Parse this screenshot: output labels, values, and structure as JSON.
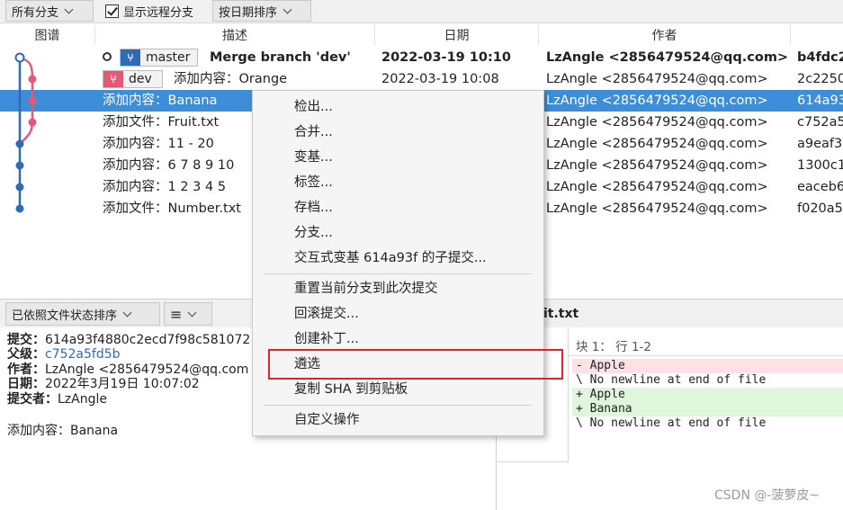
{
  "toolbar": {
    "branch_filter": "所有分支",
    "show_remote_label": "显示远程分支",
    "sort_label": "按日期排序"
  },
  "columns": {
    "graph": "图谱",
    "desc": "描述",
    "date": "日期",
    "author": "作者"
  },
  "commits": [
    {
      "desc": "Merge branch 'dev'",
      "date": "2022-03-19 10:10",
      "author": "LzAngle <2856479524@qq.com>",
      "sha": "b4fdc2"
    },
    {
      "desc": "添加内容：Orange",
      "date": "2022-03-19 10:08",
      "author": "LzAngle <2856479524@qq.com>",
      "sha": "2c2250"
    },
    {
      "desc": "添加内容：Banana",
      "date": "",
      "author": "LzAngle <2856479524@qq.com>",
      "sha": "614a93"
    },
    {
      "desc": "添加文件：Fruit.txt",
      "date": "",
      "author": "LzAngle <2856479524@qq.com>",
      "sha": "c752a5"
    },
    {
      "desc": "添加内容：11 - 20",
      "date": "",
      "author": "LzAngle <2856479524@qq.com>",
      "sha": "a9eaf3"
    },
    {
      "desc": "添加内容：6 7 8 9 10",
      "date": "",
      "author": "LzAngle <2856479524@qq.com>",
      "sha": "1300c1"
    },
    {
      "desc": "添加内容：1 2 3 4 5",
      "date": "",
      "author": "LzAngle <2856479524@qq.com>",
      "sha": "eaceb6"
    },
    {
      "desc": "添加文件：Number.txt",
      "date": "",
      "author": "LzAngle <2856479524@qq.com>",
      "sha": "f020a5"
    }
  ],
  "branches": {
    "master": "master",
    "dev": "dev",
    "master_color": "#2f6ab7",
    "dev_color": "#e25a78"
  },
  "bottom": {
    "sort_label": "已依照文件状态排序",
    "list_icon": "≡",
    "file_title": "it.txt",
    "hunk_label": "块 1： 行 1-2"
  },
  "details": {
    "commit_label": "提交：",
    "commit_value": "614a93f4880c2ecd7f98c581072",
    "parent_label": "父级：",
    "parent_value": "c752a5fd5b",
    "author_label": "作者：",
    "author_value": "LzAngle <2856479524@qq.com",
    "date_label": "日期：",
    "date_value": "2022年3月19日 10:07:02",
    "committer_label": "提交者：",
    "committer_value": "LzAngle",
    "message": "添加内容：Banana"
  },
  "diff": [
    {
      "text": "- Apple",
      "kind": "del"
    },
    {
      "text": "\\ No newline at end of file",
      "kind": "ctx"
    },
    {
      "text": "+ Apple",
      "kind": "add"
    },
    {
      "text": "+ Banana",
      "kind": "add"
    },
    {
      "text": "\\ No newline at end of file",
      "kind": "ctx"
    }
  ],
  "menu": {
    "checkout": "检出...",
    "merge": "合并...",
    "rebase": "变基...",
    "tag": "标签...",
    "archive": "存档...",
    "branch": "分支...",
    "interactive_rebase": "交互式变基 614a93f 的子提交...",
    "reset": "重置当前分支到此次提交",
    "revert": "回滚提交...",
    "patch": "创建补丁...",
    "cherry_pick": "遴选",
    "copy_sha": "复制 SHA 到剪贴板",
    "custom": "自定义操作"
  },
  "watermark": "CSDN @-菠萝皮~"
}
